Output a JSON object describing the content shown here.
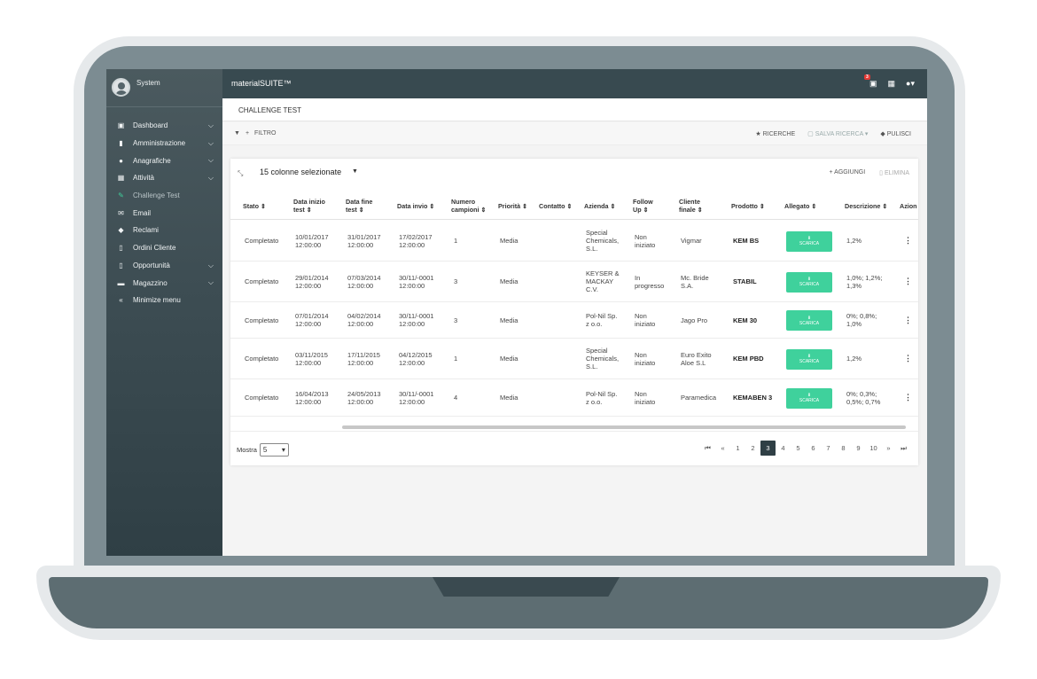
{
  "sidebar": {
    "user": "System",
    "items": [
      {
        "label": "Dashboard",
        "icon": "dashboard-icon",
        "chevron": true
      },
      {
        "label": "Amministrazione",
        "icon": "lock-icon",
        "chevron": true
      },
      {
        "label": "Anagrafiche",
        "icon": "users-icon",
        "chevron": true
      },
      {
        "label": "Attività",
        "icon": "calendar-icon",
        "chevron": true
      },
      {
        "label": "Challenge Test",
        "icon": "pencil-icon",
        "chevron": false,
        "active": true
      },
      {
        "label": "Email",
        "icon": "envelope-icon",
        "chevron": false
      },
      {
        "label": "Reclami",
        "icon": "comments-icon",
        "chevron": false
      },
      {
        "label": "Ordini Cliente",
        "icon": "file-icon",
        "chevron": false
      },
      {
        "label": "Opportunità",
        "icon": "file-icon",
        "chevron": true
      },
      {
        "label": "Magazzino",
        "icon": "warehouse-icon",
        "chevron": true
      },
      {
        "label": "Minimize menu",
        "icon": "double-chevron-left-icon",
        "chevron": false
      }
    ]
  },
  "topbar": {
    "brand": "materialSUITE™",
    "notification_count": "3"
  },
  "breadcrumb": "CHALLENGE TEST",
  "filterbar": {
    "filter_label": "FILTRO",
    "ricerche_label": "RICERCHE",
    "salva_label": "SALVA RICERCA",
    "pulisci_label": "PULISCI"
  },
  "table": {
    "columns_selected": "15 colonne selezionate",
    "add_label": "AGGIUNGI",
    "delete_label": "ELIMINA",
    "headers": [
      [
        "Stato ⇕"
      ],
      [
        "Data inizio",
        "test ⇕"
      ],
      [
        "Data fine",
        "test ⇕"
      ],
      [
        "Data invio ⇕"
      ],
      [
        "Numero",
        "campioni ⇕"
      ],
      [
        "Priorità ⇕"
      ],
      [
        "Contatto ⇕"
      ],
      [
        "Azienda ⇕"
      ],
      [
        "Follow",
        "Up ⇕"
      ],
      [
        "Cliente",
        "finale ⇕"
      ],
      [
        "Prodotto ⇕"
      ],
      [
        "Allegato ⇕"
      ],
      [
        "Descrizione ⇕"
      ],
      [
        "Azion"
      ]
    ],
    "download_label": "SCARICA",
    "rows": [
      {
        "stato": "Completato",
        "inizio": [
          "10/01/2017",
          "12:00:00"
        ],
        "fine": [
          "31/01/2017",
          "12:00:00"
        ],
        "invio": [
          "17/02/2017",
          "12:00:00"
        ],
        "campioni": "1",
        "priorita": "Media",
        "contatto": "",
        "azienda": [
          "Special",
          "Chemicals,",
          "S.L."
        ],
        "follow": [
          "Non",
          "iniziato"
        ],
        "cliente": [
          "Vigmar"
        ],
        "prodotto": "KEM BS",
        "descrizione": [
          "1,2%"
        ]
      },
      {
        "stato": "Completato",
        "inizio": [
          "29/01/2014",
          "12:00:00"
        ],
        "fine": [
          "07/03/2014",
          "12:00:00"
        ],
        "invio": [
          "30/11/-0001",
          "12:00:00"
        ],
        "campioni": "3",
        "priorita": "Media",
        "contatto": "",
        "azienda": [
          "KEYSER &",
          "MACKAY",
          "C.V."
        ],
        "follow": [
          "In",
          "progresso"
        ],
        "cliente": [
          "Mc. Bride",
          "S.A."
        ],
        "prodotto": "STABIL",
        "descrizione": [
          "1,0%; 1,2%;",
          "1,3%"
        ]
      },
      {
        "stato": "Completato",
        "inizio": [
          "07/01/2014",
          "12:00:00"
        ],
        "fine": [
          "04/02/2014",
          "12:00:00"
        ],
        "invio": [
          "30/11/-0001",
          "12:00:00"
        ],
        "campioni": "3",
        "priorita": "Media",
        "contatto": "",
        "azienda": [
          "Pol-Nil Sp.",
          "z o.o."
        ],
        "follow": [
          "Non",
          "iniziato"
        ],
        "cliente": [
          "Jago Pro"
        ],
        "prodotto": "KEM 30",
        "descrizione": [
          "0%; 0,8%;",
          "1,0%"
        ]
      },
      {
        "stato": "Completato",
        "inizio": [
          "03/11/2015",
          "12:00:00"
        ],
        "fine": [
          "17/11/2015",
          "12:00:00"
        ],
        "invio": [
          "04/12/2015",
          "12:00:00"
        ],
        "campioni": "1",
        "priorita": "Media",
        "contatto": "",
        "azienda": [
          "Special",
          "Chemicals,",
          "S.L."
        ],
        "follow": [
          "Non",
          "iniziato"
        ],
        "cliente": [
          "Euro Exito",
          "Aloe S.L"
        ],
        "prodotto": "KEM PBD",
        "descrizione": [
          "1,2%"
        ]
      },
      {
        "stato": "Completato",
        "inizio": [
          "16/04/2013",
          "12:00:00"
        ],
        "fine": [
          "24/05/2013",
          "12:00:00"
        ],
        "invio": [
          "30/11/-0001",
          "12:00:00"
        ],
        "campioni": "4",
        "priorita": "Media",
        "contatto": "",
        "azienda": [
          "Pol-Nil Sp.",
          "z o.o."
        ],
        "follow": [
          "Non",
          "iniziato"
        ],
        "cliente": [
          "Paramedica"
        ],
        "prodotto": "KEMABEN 3",
        "descrizione": [
          "0%; 0,3%;",
          "0,5%; 0,7%"
        ]
      }
    ]
  },
  "footer": {
    "mostra_label": "Mostra",
    "page_size": "5",
    "pages": [
      "1",
      "2",
      "3",
      "4",
      "5",
      "6",
      "7",
      "8",
      "9",
      "10"
    ],
    "current_page": "3"
  }
}
